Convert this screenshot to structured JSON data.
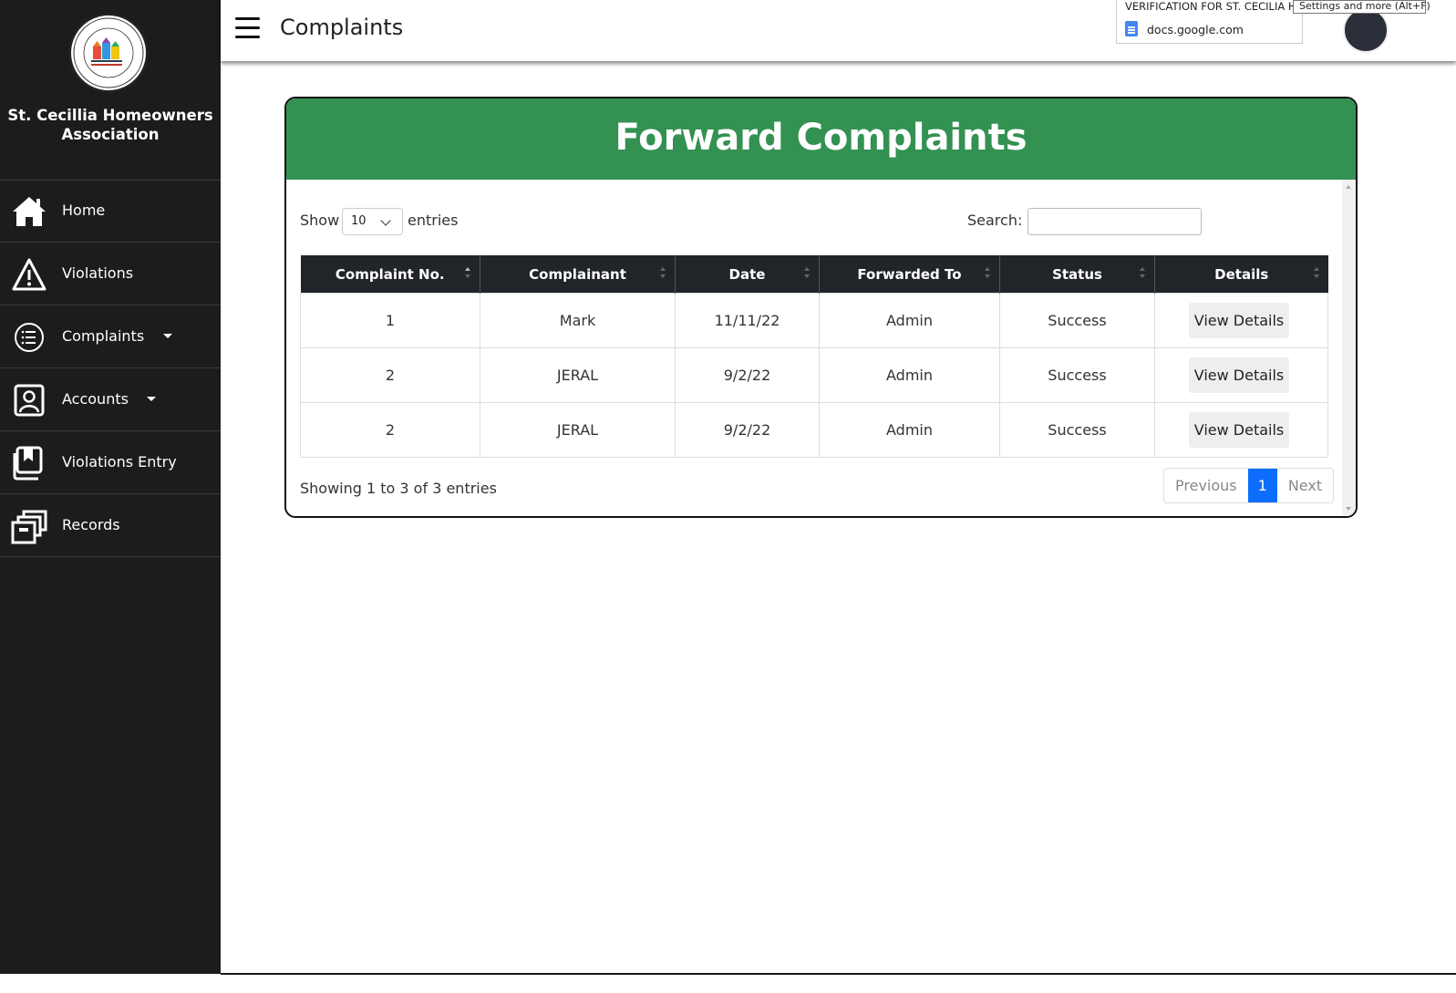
{
  "sidebar": {
    "org_name": "St. Cecillia Homeowners Association",
    "items": [
      {
        "label": "Home",
        "icon": "home-icon"
      },
      {
        "label": "Violations",
        "icon": "warning-icon"
      },
      {
        "label": "Complaints",
        "icon": "list-icon",
        "has_dropdown": true
      },
      {
        "label": "Accounts",
        "icon": "account-icon",
        "has_dropdown": true
      },
      {
        "label": "Violations Entry",
        "icon": "bookmark-entry-icon"
      },
      {
        "label": "Records",
        "icon": "archive-icon"
      }
    ]
  },
  "topbar": {
    "title": "Complaints"
  },
  "browser_tooltip": {
    "tab_title": "VERIFICATION FOR ST. CECILIA HOA",
    "tab_url": "docs.google.com",
    "settings_tip": "Settings and more (Alt+F)"
  },
  "card": {
    "title": "Forward Complaints",
    "show_label": "Show",
    "entries_value": "10",
    "entries_label": "entries",
    "search_label": "Search:",
    "search_value": ""
  },
  "table": {
    "columns": [
      "Complaint No.",
      "Complainant",
      "Date",
      "Forwarded To",
      "Status",
      "Details"
    ],
    "rows": [
      {
        "no": "1",
        "complainant": "Mark",
        "date": "11/11/22",
        "forwarded_to": "Admin",
        "status": "Success",
        "details": "View Details"
      },
      {
        "no": "2",
        "complainant": "JERAL",
        "date": "9/2/22",
        "forwarded_to": "Admin",
        "status": "Success",
        "details": "View Details"
      },
      {
        "no": "2",
        "complainant": "JERAL",
        "date": "9/2/22",
        "forwarded_to": "Admin",
        "status": "Success",
        "details": "View Details"
      }
    ]
  },
  "footer": {
    "info": "Showing 1 to 3 of 3 entries",
    "previous": "Previous",
    "page": "1",
    "next": "Next"
  },
  "colors": {
    "sidebar_bg": "#1c1c1c",
    "header_green": "#339152",
    "table_head": "#212529",
    "status_success": "#2e8540",
    "pager_active": "#0d6efd"
  }
}
